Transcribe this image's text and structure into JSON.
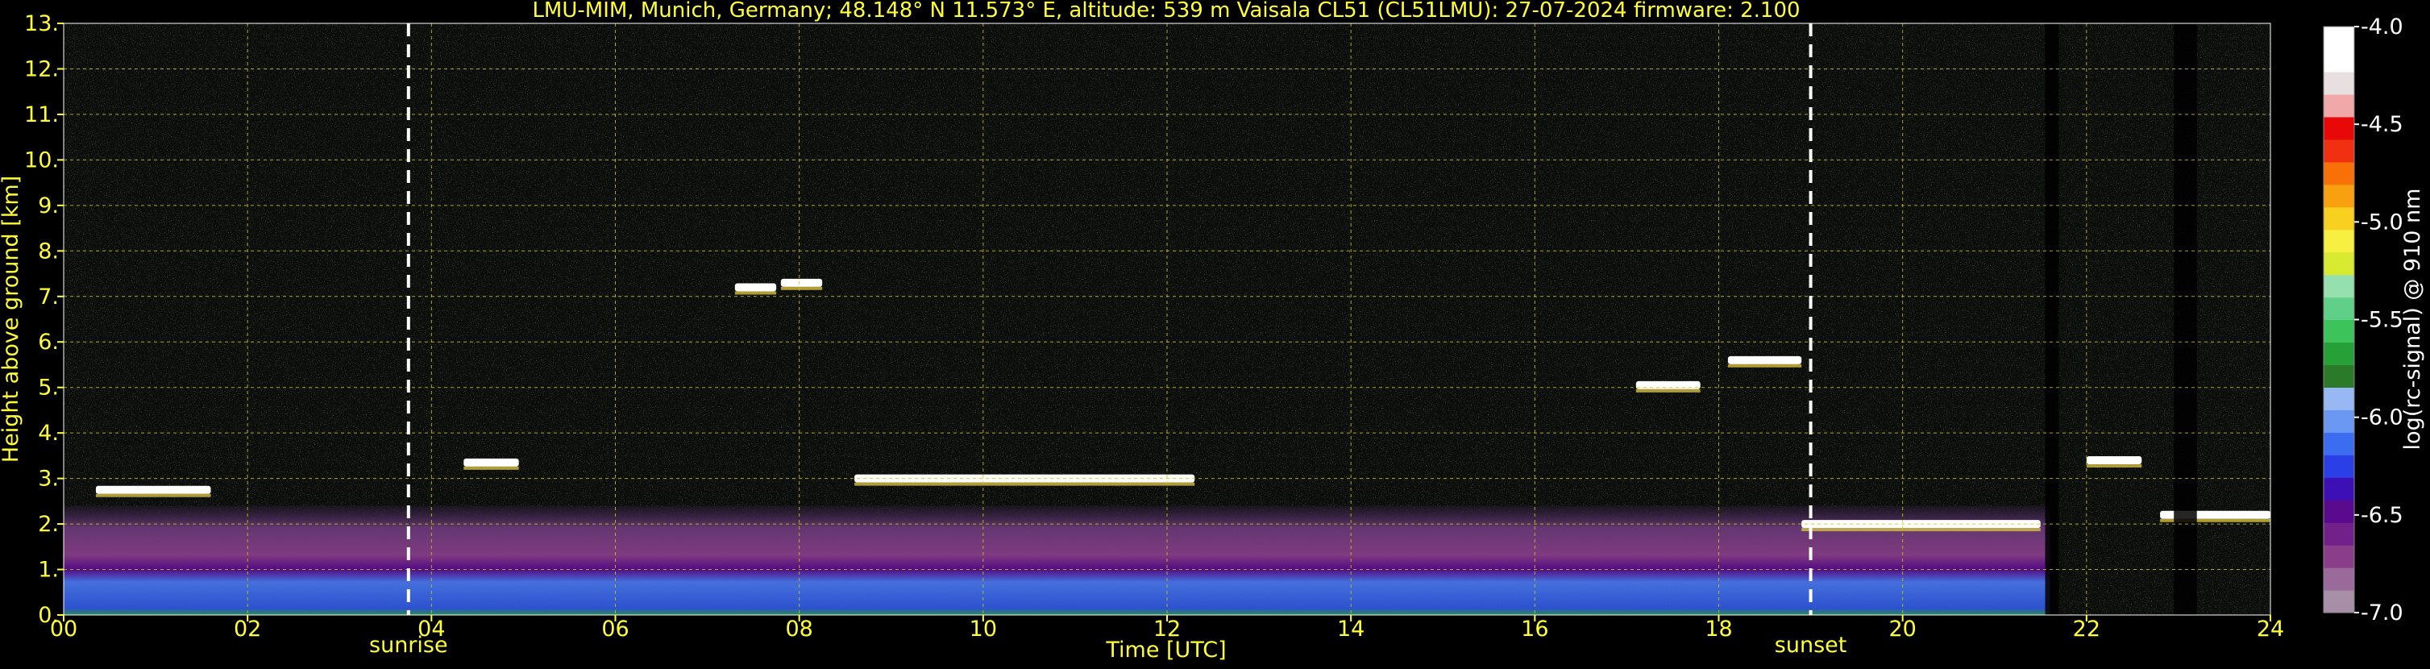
{
  "chart_data": {
    "type": "heatmap",
    "title": "LMU-MIM, Munich, Germany; 48.148° N 11.573° E, altitude: 539 m    Vaisala CL51 (CL51LMU): 27-07-2024    firmware: 2.100",
    "xlabel": "Time [UTC]",
    "ylabel": "Height above ground [km]",
    "xlim": [
      0,
      24
    ],
    "ylim": [
      0,
      13
    ],
    "x_ticks": [
      0,
      2,
      4,
      6,
      8,
      10,
      12,
      14,
      16,
      18,
      20,
      22,
      24
    ],
    "x_tick_labels": [
      "00",
      "02",
      "04",
      "06",
      "08",
      "10",
      "12",
      "14",
      "16",
      "18",
      "20",
      "22",
      "24"
    ],
    "y_ticks": [
      0,
      1,
      2,
      3,
      4,
      5,
      6,
      7,
      8,
      9,
      10,
      11,
      12,
      13
    ],
    "y_tick_labels": [
      "0.",
      "1.",
      "2.",
      "3.",
      "4.",
      "5.",
      "6.",
      "7.",
      "8.",
      "9.",
      "10.",
      "11.",
      "12.",
      "13."
    ],
    "grid": true,
    "annotations": [
      {
        "label": "sunrise",
        "x": 3.75
      },
      {
        "label": "sunset",
        "x": 19.0
      }
    ],
    "colorbar": {
      "label": "log(rc-signal) @ 910 nm",
      "range": [
        -7.0,
        -4.0
      ],
      "ticks": [
        -4.0,
        -4.5,
        -5.0,
        -5.5,
        -6.0,
        -6.5,
        -7.0
      ],
      "tick_labels": [
        "-4.0",
        "-4.5",
        "-5.0",
        "-5.5",
        "-6.0",
        "-6.5",
        "-7.0"
      ],
      "colors": [
        "#a88fa8",
        "#9a6a9a",
        "#8a3e8a",
        "#72208a",
        "#5a0a8c",
        "#3c10b4",
        "#2a40e6",
        "#3c6cf0",
        "#6a98f2",
        "#98b8f4",
        "#2a7a2a",
        "#28a038",
        "#3cc45a",
        "#60d088",
        "#96e0b0",
        "#d8ea30",
        "#f8f040",
        "#f8d020",
        "#f8a010",
        "#f87008",
        "#f03010",
        "#e80808",
        "#f0a8a8",
        "#e8e0e0",
        "#ffffff",
        "#ffffff"
      ]
    },
    "style": {
      "tick_color": "#ffff33",
      "grid_color": "#c8c800",
      "background": "#000000"
    },
    "features": [
      {
        "kind": "aerosol_layer",
        "t_start": 0,
        "t_end": 21.6,
        "h_bottom": 0,
        "h_top": 2.4
      },
      {
        "kind": "cloud",
        "t_start": 0.35,
        "t_end": 1.6,
        "height": 2.75
      },
      {
        "kind": "cloud",
        "t_start": 4.35,
        "t_end": 4.95,
        "height": 3.35
      },
      {
        "kind": "cloud",
        "t_start": 8.6,
        "t_end": 12.3,
        "height": 3.0
      },
      {
        "kind": "cloud",
        "t_start": 7.3,
        "t_end": 7.75,
        "height": 7.2
      },
      {
        "kind": "cloud",
        "t_start": 7.8,
        "t_end": 8.25,
        "height": 7.3
      },
      {
        "kind": "cloud",
        "t_start": 17.1,
        "t_end": 17.8,
        "height": 5.05
      },
      {
        "kind": "cloud",
        "t_start": 18.1,
        "t_end": 18.9,
        "height": 5.6
      },
      {
        "kind": "cloud",
        "t_start": 18.9,
        "t_end": 21.5,
        "height": 2.0
      },
      {
        "kind": "cloud",
        "t_start": 22.0,
        "t_end": 22.6,
        "height": 3.4
      },
      {
        "kind": "cloud",
        "t_start": 22.8,
        "t_end": 24.0,
        "height": 2.2
      }
    ]
  }
}
